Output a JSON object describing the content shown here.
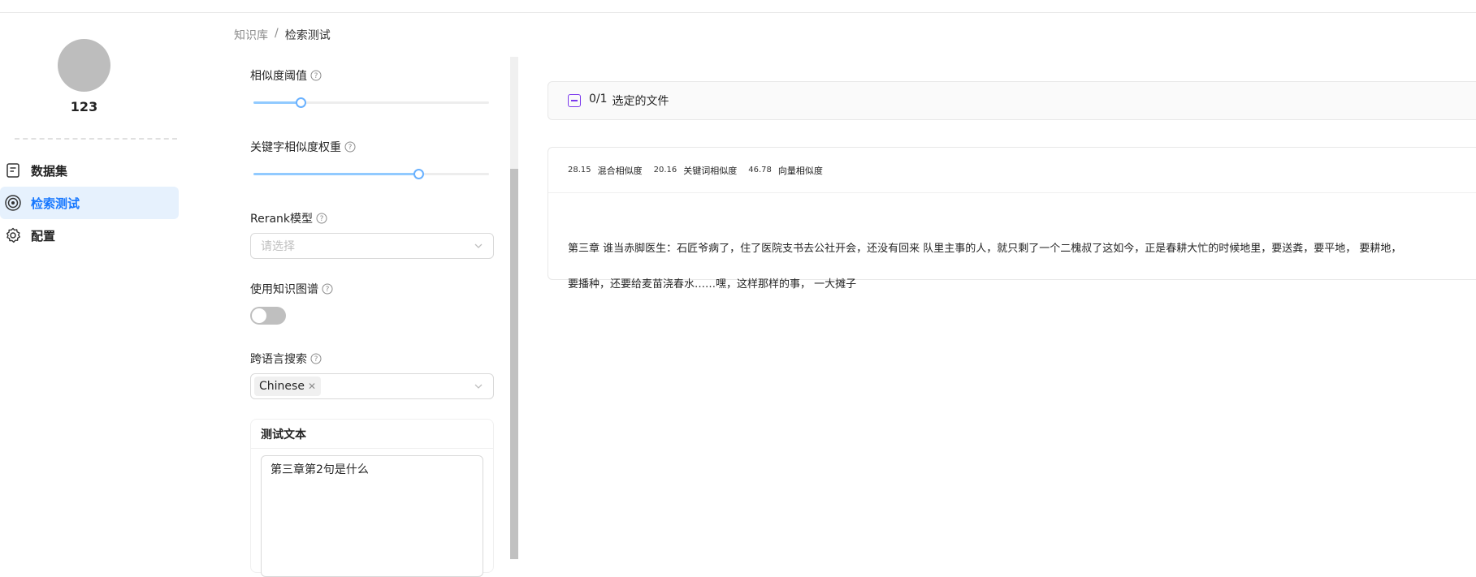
{
  "user": {
    "name": "123"
  },
  "nav": {
    "items": [
      {
        "label": "数据集",
        "icon": "document-icon",
        "active": false
      },
      {
        "label": "检索测试",
        "icon": "target-icon",
        "active": true
      },
      {
        "label": "配置",
        "icon": "gear-icon",
        "active": false
      }
    ]
  },
  "breadcrumb": {
    "root": "知识库",
    "separator": "/",
    "current": "检索测试"
  },
  "settings": {
    "similarity_threshold": {
      "label": "相似度阈值",
      "value": 0.2
    },
    "keyword_weight": {
      "label": "关键字相似度权重",
      "value": 0.7
    },
    "rerank": {
      "label": "Rerank模型",
      "placeholder": "请选择"
    },
    "knowledge_graph": {
      "label": "使用知识图谱",
      "enabled": false
    },
    "cross_language": {
      "label": "跨语言搜索",
      "selected_tag": "Chinese"
    },
    "test_text": {
      "title": "测试文本",
      "value": "第三章第2句是什么"
    }
  },
  "results": {
    "file_selection": {
      "count": "0/1",
      "label": "选定的文件"
    },
    "items": [
      {
        "hybrid_score": "28.15",
        "hybrid_label": "混合相似度",
        "keyword_score": "20.16",
        "keyword_label": "关键词相似度",
        "vector_score": "46.78",
        "vector_label": "向量相似度",
        "text_line1": "第三章 谁当赤脚医生：石匠爷病了，住了医院支书去公社开会，还没有回来 队里主事的人，就只剩了一个二槐叔了这如今，正是春耕大忙的时候地里，要送粪，要平地， 要耕地，",
        "text_line2": "要播种，还要给麦苗浇春水……嘿，这样那样的事， 一大摊子"
      }
    ]
  },
  "colors": {
    "accent": "#1677ff",
    "active_bg": "#e6f1fd",
    "checkbox": "#7c3aed"
  }
}
